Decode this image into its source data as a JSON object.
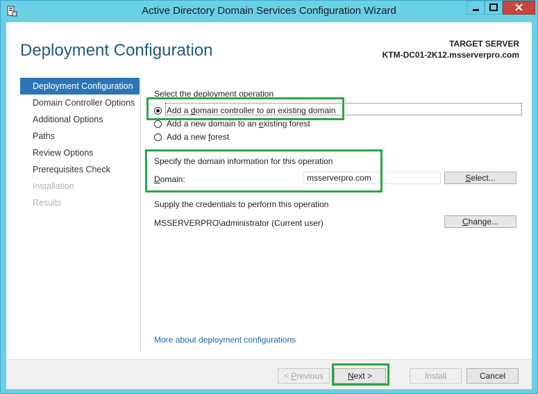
{
  "window": {
    "title": "Active Directory Domain Services Configuration Wizard",
    "buttons": {
      "minimize": "minimize-icon",
      "maximize": "maximize-icon",
      "close": "close-icon"
    }
  },
  "header": {
    "page_title": "Deployment Configuration",
    "target_label": "TARGET SERVER",
    "target_value": "KTM-DC01-2K12.msserverpro.com"
  },
  "nav": {
    "items": [
      {
        "label": "Deployment Configuration",
        "state": "active"
      },
      {
        "label": "Domain Controller Options",
        "state": "normal"
      },
      {
        "label": "Additional Options",
        "state": "normal"
      },
      {
        "label": "Paths",
        "state": "normal"
      },
      {
        "label": "Review Options",
        "state": "normal"
      },
      {
        "label": "Prerequisites Check",
        "state": "normal"
      },
      {
        "label": "Installation",
        "state": "disabled"
      },
      {
        "label": "Results",
        "state": "disabled"
      }
    ]
  },
  "main": {
    "operation_heading": "Select the deployment operation",
    "options": [
      {
        "pre": "Add a ",
        "key": "d",
        "post": "omain controller to an existing domain",
        "checked": true
      },
      {
        "pre": "Add a new domain to an ",
        "key": "e",
        "post": "xisting forest",
        "checked": false
      },
      {
        "pre": "Add a new ",
        "key": "f",
        "post": "orest",
        "checked": false
      }
    ],
    "domain_heading": "Specify the domain information for this operation",
    "domain_label_key": "D",
    "domain_label_rest": "omain:",
    "domain_value": "msserverpro.com",
    "select_key": "S",
    "select_rest": "elect...",
    "cred_heading": "Supply the credentials to perform this operation",
    "cred_user": "MSSERVERPRO\\administrator (Current user)",
    "change_key": "C",
    "change_rest": "hange...",
    "more_link": "More about deployment configurations"
  },
  "footer": {
    "previous_pre": "< ",
    "previous_key": "P",
    "previous_post": "revious",
    "next_key": "N",
    "next_post": "ext >",
    "install_label": "Install",
    "cancel_label": "Cancel"
  },
  "colors": {
    "highlight": "#2ea44a",
    "accent": "#2a75b8",
    "title_bar": "#6ad0e6",
    "close": "#c7463d"
  }
}
